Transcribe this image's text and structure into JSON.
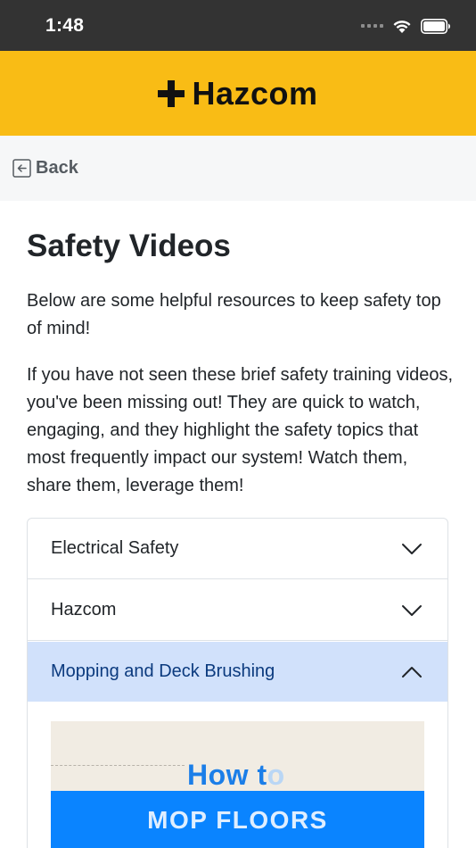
{
  "status_bar": {
    "time": "1:48",
    "icons": [
      "signal-dots-icon",
      "wifi-icon",
      "battery-icon"
    ]
  },
  "header": {
    "brand_name": "Hazcom",
    "brand_icon": "plus-icon",
    "background_color": "#f9bc15"
  },
  "nav": {
    "back_label": "Back",
    "back_icon": "back-arrow-icon"
  },
  "main": {
    "title": "Safety Videos",
    "intro_paragraphs": [
      "Below are some helpful resources to keep safety top of mind!",
      "If you have not seen these brief safety training videos, you've been missing out! They are quick to watch, engaging, and they highlight the safety topics that most frequently impact our system! Watch them, share them, leverage them!"
    ]
  },
  "accordion": {
    "items": [
      {
        "label": "Electrical Safety",
        "expanded": false
      },
      {
        "label": "Hazcom",
        "expanded": false
      },
      {
        "label": "Mopping and Deck Brushing",
        "expanded": true
      }
    ],
    "active_color": "#d1e1fb"
  },
  "video": {
    "heading": "How t",
    "heading_faded": "o",
    "title": "MOP FLOORS",
    "accent_color": "#0a84ff"
  }
}
